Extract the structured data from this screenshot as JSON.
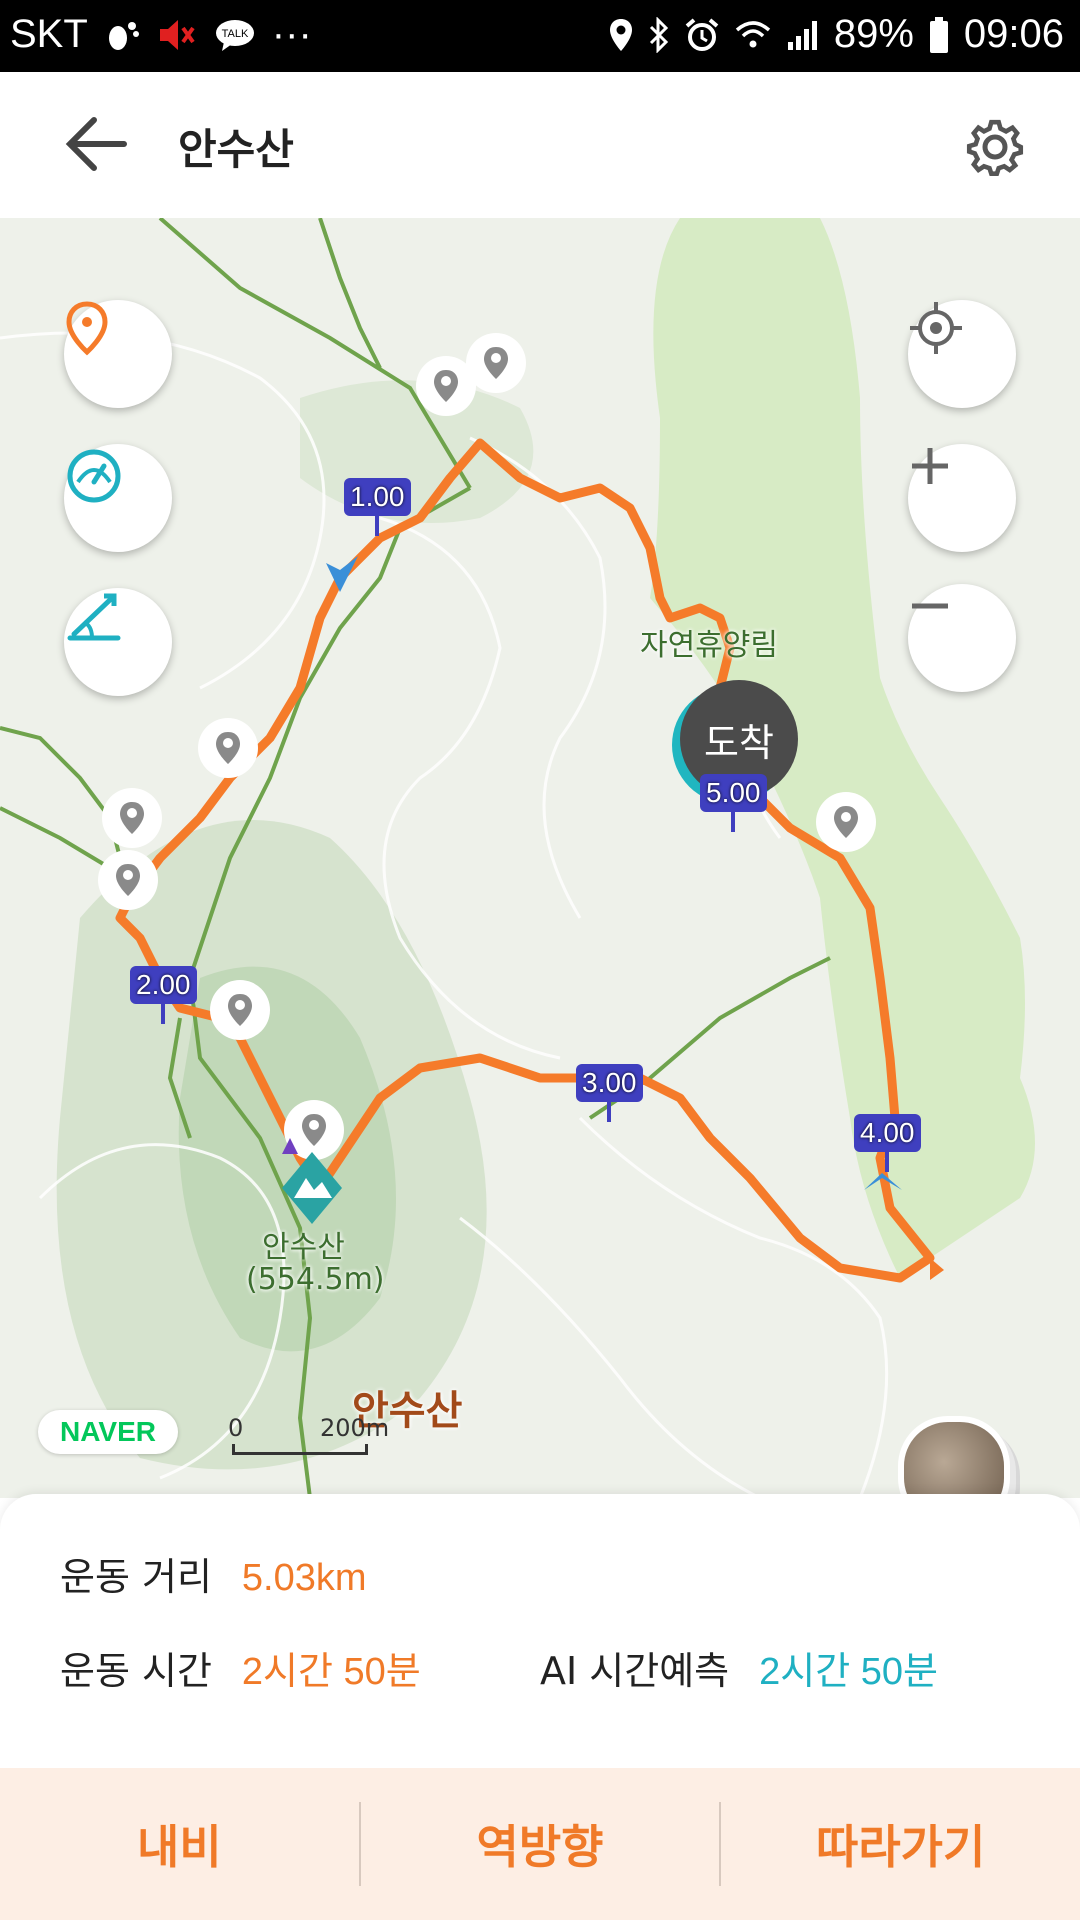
{
  "status_bar": {
    "carrier": "SKT",
    "battery": "89%",
    "time": "09:06",
    "more": "···",
    "icons": [
      "footprint-icon",
      "volume-mute-icon",
      "talk-icon",
      "location-icon",
      "bluetooth-icon",
      "alarm-icon",
      "wifi-icon",
      "signal-icon",
      "battery-icon"
    ]
  },
  "header": {
    "title": "안수산",
    "back_icon": "arrow-left-icon",
    "settings_icon": "gear-icon"
  },
  "map": {
    "peak_name": "안수산",
    "peak_label": "안수산",
    "peak_elevation": "(554.5m)",
    "forest_label": "자연휴양림",
    "arrival_label": "도착",
    "km_markers": [
      "1.00",
      "2.00",
      "3.00",
      "4.00",
      "5.00"
    ],
    "brand": "NAVER",
    "scale_zero": "0",
    "scale_distance": "200m",
    "colors": {
      "route": "#f57b2a",
      "trail": "#6fa34c",
      "forest": "#d7ebc5",
      "accent": "#1fb0c2"
    }
  },
  "stats": {
    "distance_label": "운동 거리",
    "distance_value": "5.03km",
    "time_label": "운동 시간",
    "time_value": "2시간 50분",
    "ai_label": "AI 시간예측",
    "ai_value": "2시간 50분"
  },
  "actions": {
    "nav": "내비",
    "reverse": "역방향",
    "follow": "따라가기"
  }
}
